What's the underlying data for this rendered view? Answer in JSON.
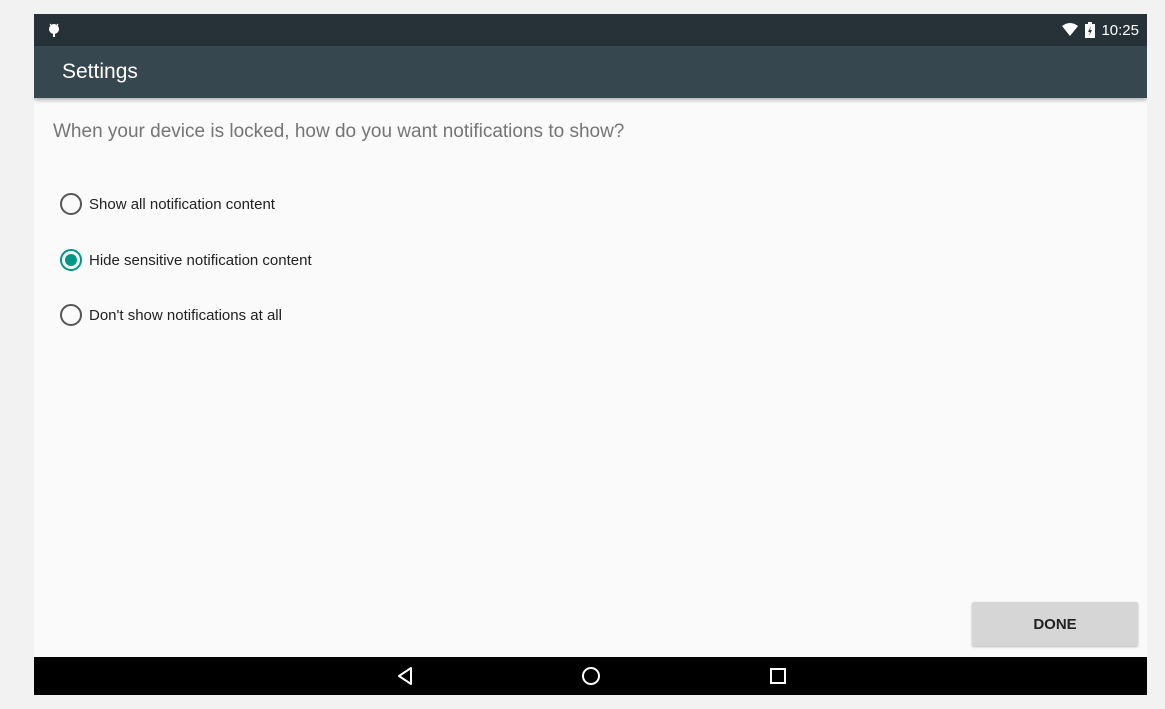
{
  "status_bar": {
    "time": "10:25",
    "left_icon": "android-debug-icon",
    "right_icons": [
      "wifi-icon",
      "battery-charging-icon"
    ]
  },
  "app_bar": {
    "title": "Settings"
  },
  "main": {
    "prompt": "When your device is locked, how do you want notifications to show?",
    "options": [
      {
        "label": "Show all notification content",
        "checked": false
      },
      {
        "label": "Hide sensitive notification content",
        "checked": true
      },
      {
        "label": "Don't show notifications at all",
        "checked": false
      }
    ],
    "done_label": "DONE"
  },
  "nav_bar": {
    "buttons": [
      "back-icon",
      "home-icon",
      "recents-icon"
    ]
  },
  "colors": {
    "status_bar": "#263238",
    "app_bar": "#37474f",
    "accent": "#009688",
    "nav_bar": "#000000"
  }
}
